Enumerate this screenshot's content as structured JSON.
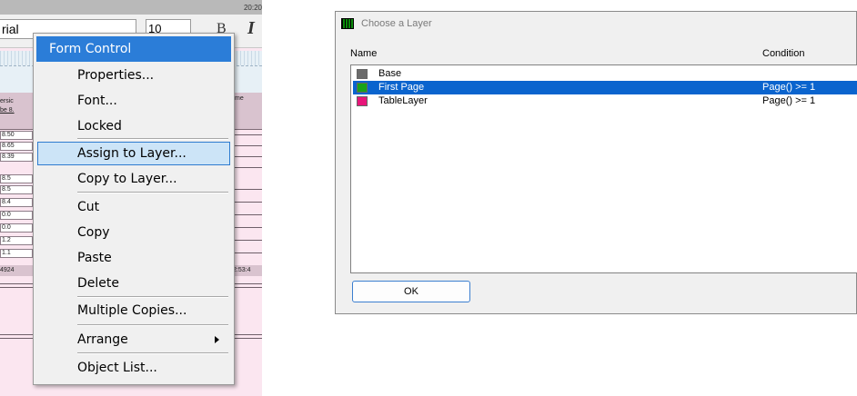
{
  "editor": {
    "clock": "20:20",
    "font_name": "rial",
    "font_size": "10",
    "bold_label": "B",
    "italic_label": "I",
    "header_left_1": "ersic",
    "header_left_2": "be 8.",
    "header_right": "me",
    "cells": [
      "8.50",
      "8.65",
      "8.39",
      "8.5",
      "8.5",
      "8.4",
      "0.0",
      "0.0",
      "1.2",
      "1.1"
    ],
    "total_left": "4924",
    "total_right": "2:53:4"
  },
  "context_menu": {
    "header": "Form Control",
    "items": [
      {
        "label": "Properties..."
      },
      {
        "label": "Font..."
      },
      {
        "label": "Locked"
      },
      {
        "label": "Assign to Layer..."
      },
      {
        "label": "Copy to Layer..."
      },
      {
        "label": "Cut"
      },
      {
        "label": "Copy"
      },
      {
        "label": "Paste"
      },
      {
        "label": "Delete"
      },
      {
        "label": "Multiple Copies..."
      },
      {
        "label": "Arrange"
      },
      {
        "label": "Object List..."
      }
    ],
    "highlighted_item": "Assign to Layer..."
  },
  "dialog": {
    "title": "Choose a Layer",
    "columns": {
      "name": "Name",
      "condition": "Condition"
    },
    "layers": [
      {
        "name": "Base",
        "condition": "",
        "color": "#6b6b6b"
      },
      {
        "name": "First Page",
        "condition": "Page() >= 1",
        "color": "#19a319"
      },
      {
        "name": "TableLayer",
        "condition": "Page() >= 1",
        "color": "#e8157a"
      }
    ],
    "selected_layer": "First Page",
    "ok_label": "OK",
    "accent_color": "#0a64ce"
  }
}
